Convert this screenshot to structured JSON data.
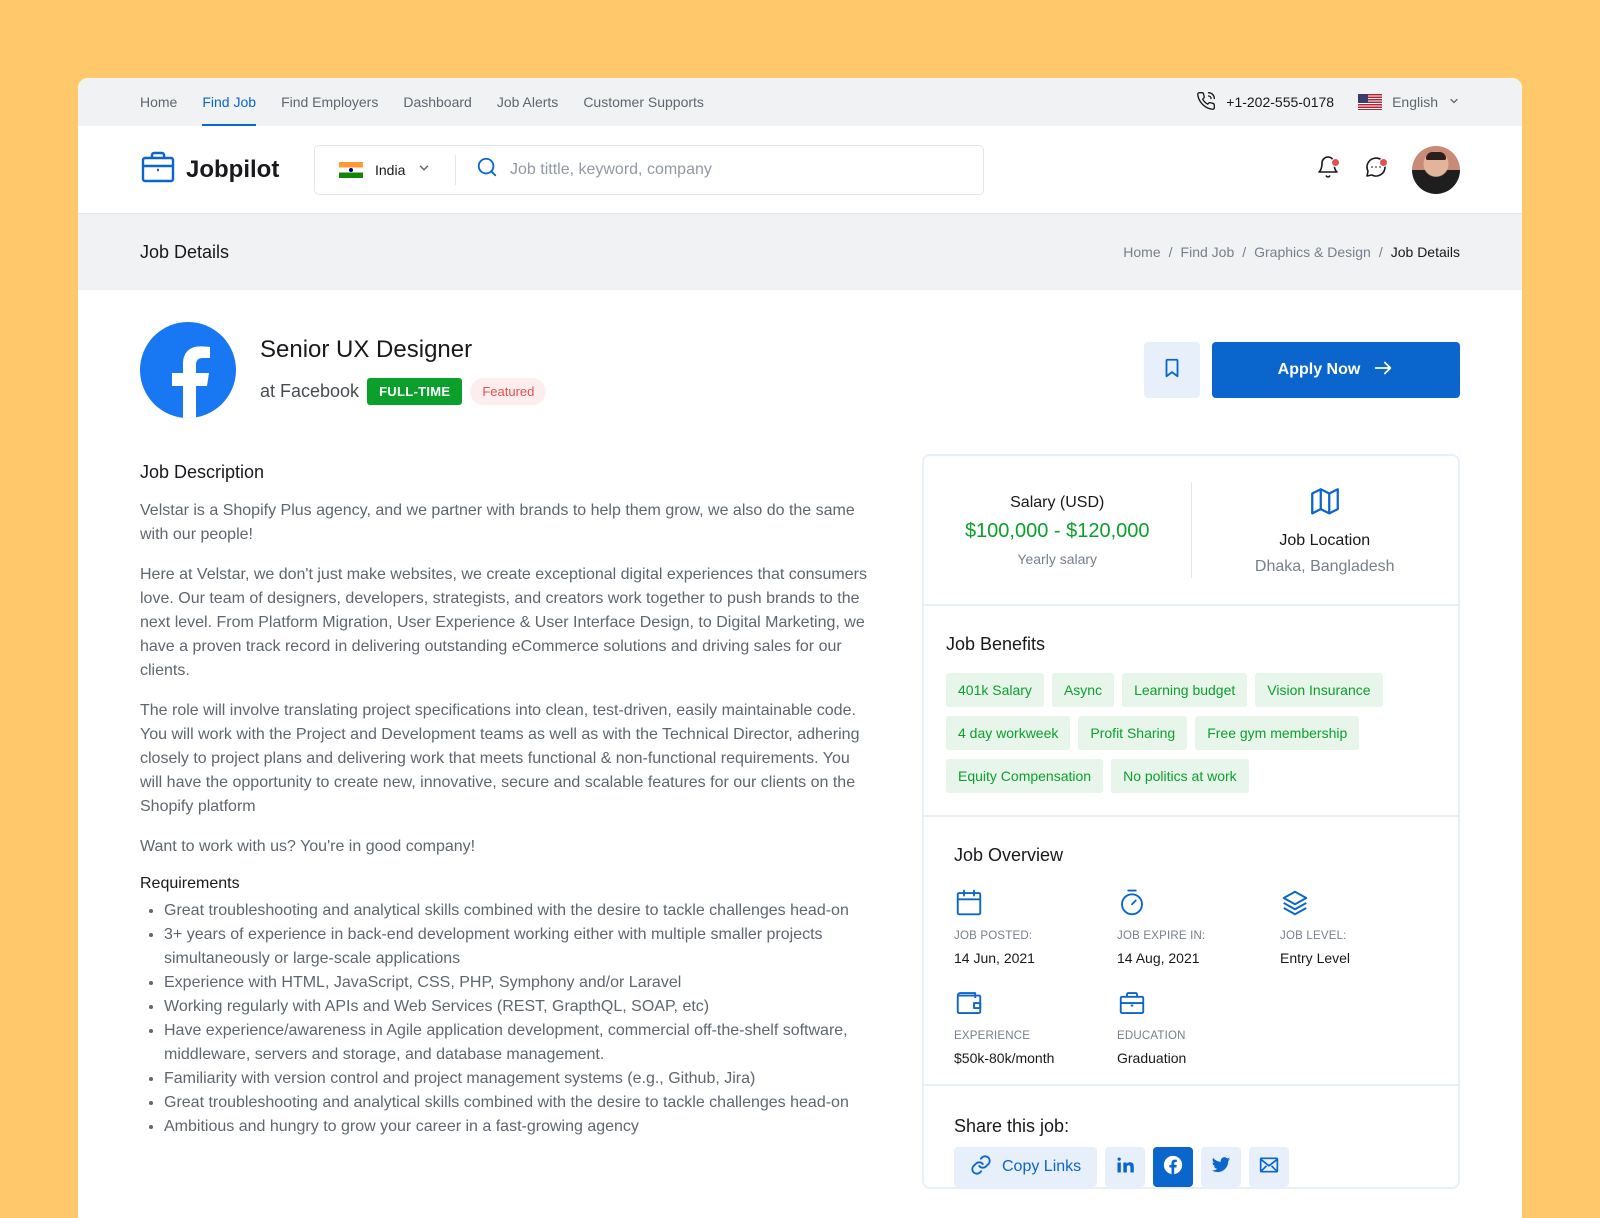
{
  "topnav": {
    "items": [
      "Home",
      "Find Job",
      "Find Employers",
      "Dashboard",
      "Job Alerts",
      "Customer Supports"
    ],
    "active": "Find Job",
    "phone": "+1-202-555-0178",
    "language": "English"
  },
  "header": {
    "logo": "Jobpilot",
    "country": "India",
    "search_placeholder": "Job tittle, keyword, company"
  },
  "page": {
    "title": "Job Details",
    "breadcrumb": [
      "Home",
      "Find Job",
      "Graphics & Design",
      "Job Details"
    ]
  },
  "job": {
    "title": "Senior UX Designer",
    "company": "at Facebook",
    "type_tag": "FULL-TIME",
    "featured_tag": "Featured",
    "apply_label": "Apply Now"
  },
  "description": {
    "heading": "Job Description",
    "paragraphs": [
      "Velstar is a Shopify Plus agency, and we partner with brands to help them grow, we also do the same with our people!",
      "Here at Velstar, we don't just make websites, we create exceptional digital experiences that consumers love. Our team of designers, developers, strategists, and creators work together to push brands to the next level. From Platform Migration, User Experience & User Interface Design, to Digital Marketing, we have a proven track record in delivering outstanding eCommerce solutions and driving sales for our clients.",
      "The role will involve translating project specifications into clean, test-driven, easily maintainable code. You will work with the Project and Development teams as well as with the Technical Director, adhering closely to project plans and delivering work that meets functional & non-functional requirements. You will have the opportunity to create new, innovative, secure and scalable features for our clients on the Shopify platform",
      "Want to work with us? You're in good company!"
    ],
    "requirements_heading": "Requirements",
    "requirements": [
      "Great troubleshooting and analytical skills combined with the desire to tackle challenges head-on",
      "3+ years of experience in back-end development working either with multiple smaller projects simultaneously or large-scale applications",
      "Experience with HTML, JavaScript, CSS, PHP, Symphony and/or Laravel",
      "Working regularly with APIs and Web Services (REST, GrapthQL, SOAP, etc)",
      "Have experience/awareness in Agile application development, commercial off-the-shelf software, middleware, servers and storage, and database management.",
      "Familiarity with version control and project management systems (e.g., Github, Jira)",
      "Great troubleshooting and analytical skills combined with the desire to tackle challenges head-on",
      "Ambitious and hungry to grow your career in a fast-growing agency"
    ]
  },
  "salary": {
    "label": "Salary (USD)",
    "amount": "$100,000 - $120,000",
    "period": "Yearly salary"
  },
  "location": {
    "label": "Job Location",
    "value": "Dhaka, Bangladesh"
  },
  "benefits": {
    "heading": "Job Benefits",
    "items": [
      "401k Salary",
      "Async",
      "Learning budget",
      "Vision Insurance",
      "4 day workweek",
      "Profit Sharing",
      "Free gym membership",
      "Equity Compensation",
      "No politics at work"
    ]
  },
  "overview": {
    "heading": "Job Overview",
    "items": [
      {
        "key": "JOB POSTED:",
        "value": "14 Jun, 2021",
        "icon": "calendar-icon"
      },
      {
        "key": "JOB EXPIRE IN:",
        "value": "14 Aug, 2021",
        "icon": "timer-icon"
      },
      {
        "key": "JOB LEVEL:",
        "value": "Entry Level",
        "icon": "stack-icon"
      },
      {
        "key": "EXPERIENCE",
        "value": "$50k-80k/month",
        "icon": "wallet-icon"
      },
      {
        "key": "EDUCATION",
        "value": "Graduation",
        "icon": "briefcase-icon"
      }
    ]
  },
  "share": {
    "heading": "Share this job:",
    "copy_label": "Copy Links"
  },
  "colors": {
    "primary": "#0A65CC",
    "green": "#0BA02C",
    "featured": "#E05151",
    "background": "#FFC96B"
  }
}
